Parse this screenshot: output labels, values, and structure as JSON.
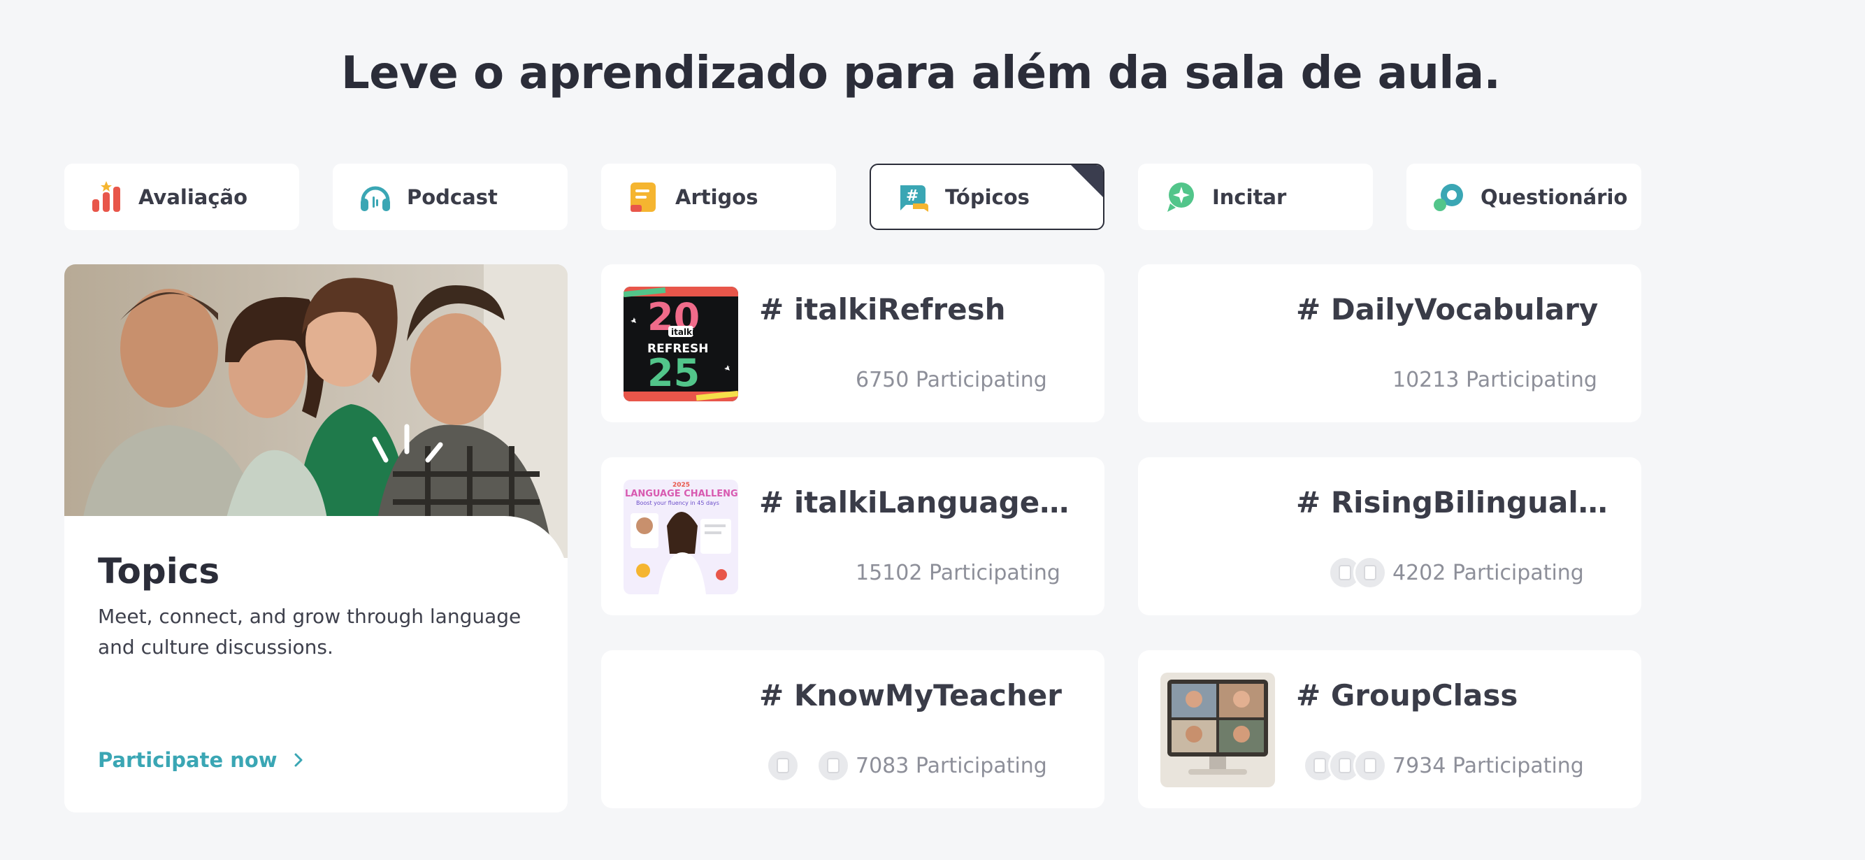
{
  "headline": "Leve o aprendizado para além da sala de aula.",
  "tabs": [
    {
      "label": "Avaliação",
      "icon": "bar-chart-icon",
      "active": false
    },
    {
      "label": "Podcast",
      "icon": "headphones-icon",
      "active": false
    },
    {
      "label": "Artigos",
      "icon": "article-icon",
      "active": false
    },
    {
      "label": "Tópicos",
      "icon": "hashtag-chat-icon",
      "active": true
    },
    {
      "label": "Incitar",
      "icon": "sparkle-chat-icon",
      "active": false
    },
    {
      "label": "Questionário",
      "icon": "quiz-chat-icon",
      "active": false
    }
  ],
  "feature": {
    "title": "Topics",
    "description": "Meet, connect, and grow through language and culture discussions.",
    "cta": "Participate now",
    "image": "group-of-friends-photo"
  },
  "topics": [
    {
      "tag": "# italkiRefresh",
      "participants": "6750 Participating",
      "thumb": "italki-refresh-2025-thumbnail"
    },
    {
      "tag": "# DailyVocabulary",
      "participants": "10213 Participating",
      "thumb": ""
    },
    {
      "tag": "# italkiLanguageChal…",
      "participants": "15102 Participating",
      "thumb": "language-challenge-thumbnail"
    },
    {
      "tag": "# RisingBilingualStar",
      "participants": "4202 Participating",
      "thumb": ""
    },
    {
      "tag": "# KnowMyTeacher",
      "participants": "7083 Participating",
      "thumb": ""
    },
    {
      "tag": "# GroupClass",
      "participants": "7934 Participating",
      "thumb": "video-call-thumbnail"
    }
  ],
  "thumb_text": {
    "refresh_top": "20",
    "refresh_brand": "italki",
    "refresh_word": "REFRESH",
    "refresh_bottom": "25",
    "challenge_year": "2025",
    "challenge_title": "LANGUAGE CHALLENGE",
    "challenge_sub": "Boost your fluency in 45 days"
  },
  "colors": {
    "accent": "#3aa6b4",
    "text_dark": "#2b2d39",
    "muted": "#8d8f99",
    "background": "#f5f6f8"
  }
}
